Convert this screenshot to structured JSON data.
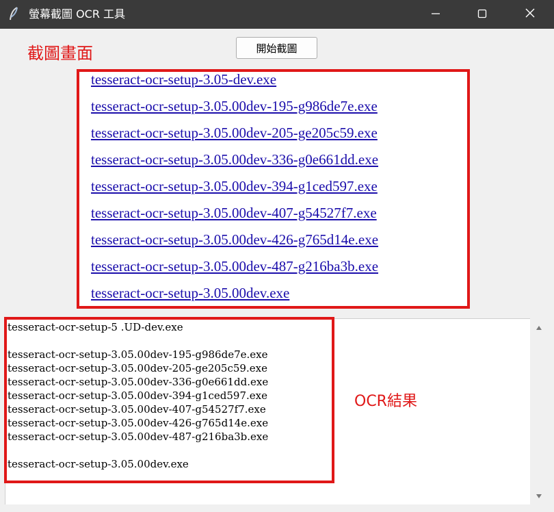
{
  "window": {
    "title": "螢幕截圖 OCR 工具",
    "app_icon": "feather-icon",
    "controls": [
      "minimize-icon",
      "maximize-icon",
      "close-icon"
    ]
  },
  "annotations": {
    "screenshot_label": "截圖畫面",
    "ocr_label": "OCR結果",
    "highlight_color": "#e01818"
  },
  "toolbar": {
    "start_label": "開始截圖"
  },
  "capture": {
    "link_color": "#1a0dab",
    "links": [
      "tesseract-ocr-setup-3.05-dev.exe",
      "tesseract-ocr-setup-3.05.00dev-195-g986de7e.exe",
      "tesseract-ocr-setup-3.05.00dev-205-ge205c59.exe",
      "tesseract-ocr-setup-3.05.00dev-336-g0e661dd.exe",
      "tesseract-ocr-setup-3.05.00dev-394-g1ced597.exe",
      "tesseract-ocr-setup-3.05.00dev-407-g54527f7.exe",
      "tesseract-ocr-setup-3.05.00dev-426-g765d14e.exe",
      "tesseract-ocr-setup-3.05.00dev-487-g216ba3b.exe",
      "tesseract-ocr-setup-3.05.00dev.exe"
    ]
  },
  "result": {
    "lines": [
      "tesseract-ocr-setup-5 .UD-dev.exe",
      "",
      "tesseract-ocr-setup-3.05.00dev-195-g986de7e.exe",
      "tesseract-ocr-setup-3.05.00dev-205-ge205c59.exe",
      "tesseract-ocr-setup-3.05.00dev-336-g0e661dd.exe",
      "tesseract-ocr-setup-3.05.00dev-394-g1ced597.exe",
      "tesseract-ocr-setup-3.05.00dev-407-g54527f7.exe",
      "tesseract-ocr-setup-3.05.00dev-426-g765d14e.exe",
      "tesseract-ocr-setup-3.05.00dev-487-g216ba3b.exe",
      "",
      "tesseract-ocr-setup-3.05.00dev.exe"
    ]
  }
}
